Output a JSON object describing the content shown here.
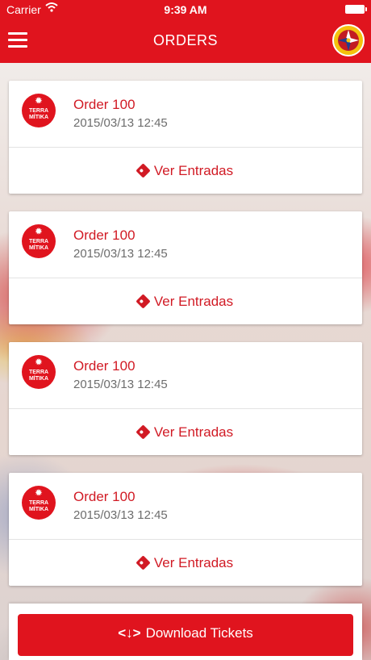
{
  "status": {
    "carrier": "Carrier",
    "time": "9:39 AM"
  },
  "nav": {
    "title": "ORDERS",
    "menu_icon": "hamburger-icon",
    "logo_icon": "compass-logo"
  },
  "colors": {
    "accent": "#e0141e",
    "accent_text": "#d11a24",
    "date_text": "#6d6d6d"
  },
  "orders": [
    {
      "logo_text": "TERRA MÍTIKA",
      "order": "Order 100",
      "date": "2015/03/13 12:45",
      "action": "Ver Entradas"
    },
    {
      "logo_text": "TERRA MÍTIKA",
      "order": "Order 100",
      "date": "2015/03/13 12:45",
      "action": "Ver Entradas"
    },
    {
      "logo_text": "TERRA MÍTIKA",
      "order": "Order 100",
      "date": "2015/03/13 12:45",
      "action": "Ver Entradas"
    },
    {
      "logo_text": "TERRA MÍTIKA",
      "order": "Order 100",
      "date": "2015/03/13 12:45",
      "action": "Ver Entradas"
    }
  ],
  "download": {
    "label": "Download Tickets"
  }
}
